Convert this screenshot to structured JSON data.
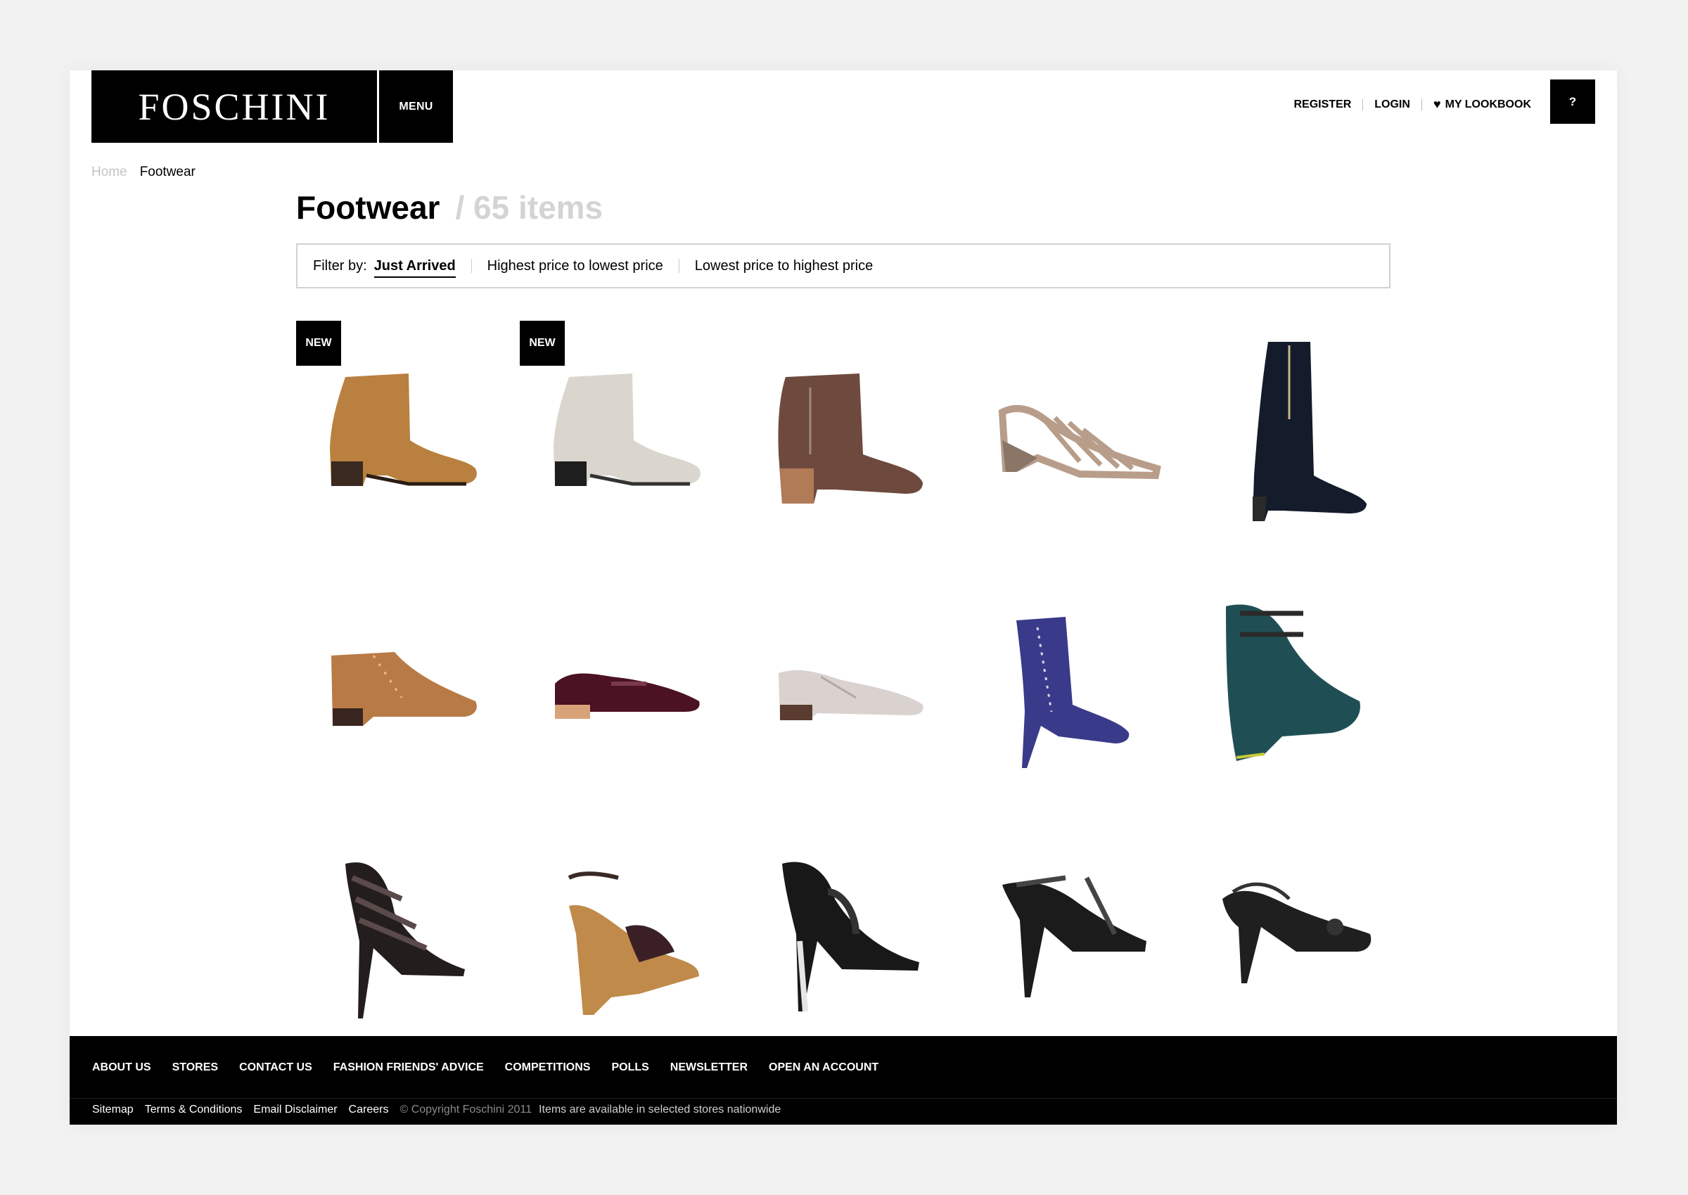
{
  "header": {
    "logo": "FOSCHINI",
    "menu_label": "MENU",
    "register": "REGISTER",
    "login": "LOGIN",
    "lookbook": "MY LOOKBOOK",
    "help": "?"
  },
  "breadcrumb": {
    "home": "Home",
    "current": "Footwear"
  },
  "main": {
    "title": "Footwear",
    "count": "/ 65 items"
  },
  "filter": {
    "label": "Filter by:",
    "options": [
      "Just Arrived",
      "Highest price to lowest price",
      "Lowest price to highest price"
    ]
  },
  "products": {
    "badge": "NEW"
  },
  "colors": {
    "tan": "#b9803f",
    "stone": "#dad5cd",
    "brown": "#6e4a3e",
    "taupe": "#b89d8a",
    "black": "#141414",
    "cognac": "#b87a46",
    "burgundy": "#4b1222",
    "blue": "#3a3a8a",
    "teal": "#1f4f54"
  },
  "footer": {
    "nav": [
      "ABOUT US",
      "STORES",
      "CONTACT US",
      "FASHION FRIENDS' ADVICE",
      "COMPETITIONS",
      "POLLS",
      "NEWSLETTER",
      "OPEN AN ACCOUNT"
    ],
    "links": [
      "Sitemap",
      "Terms & Conditions",
      "Email Disclaimer",
      "Careers"
    ],
    "copyright": "© Copyright Foschini 2011",
    "note": "Items are available in selected stores nationwide"
  }
}
